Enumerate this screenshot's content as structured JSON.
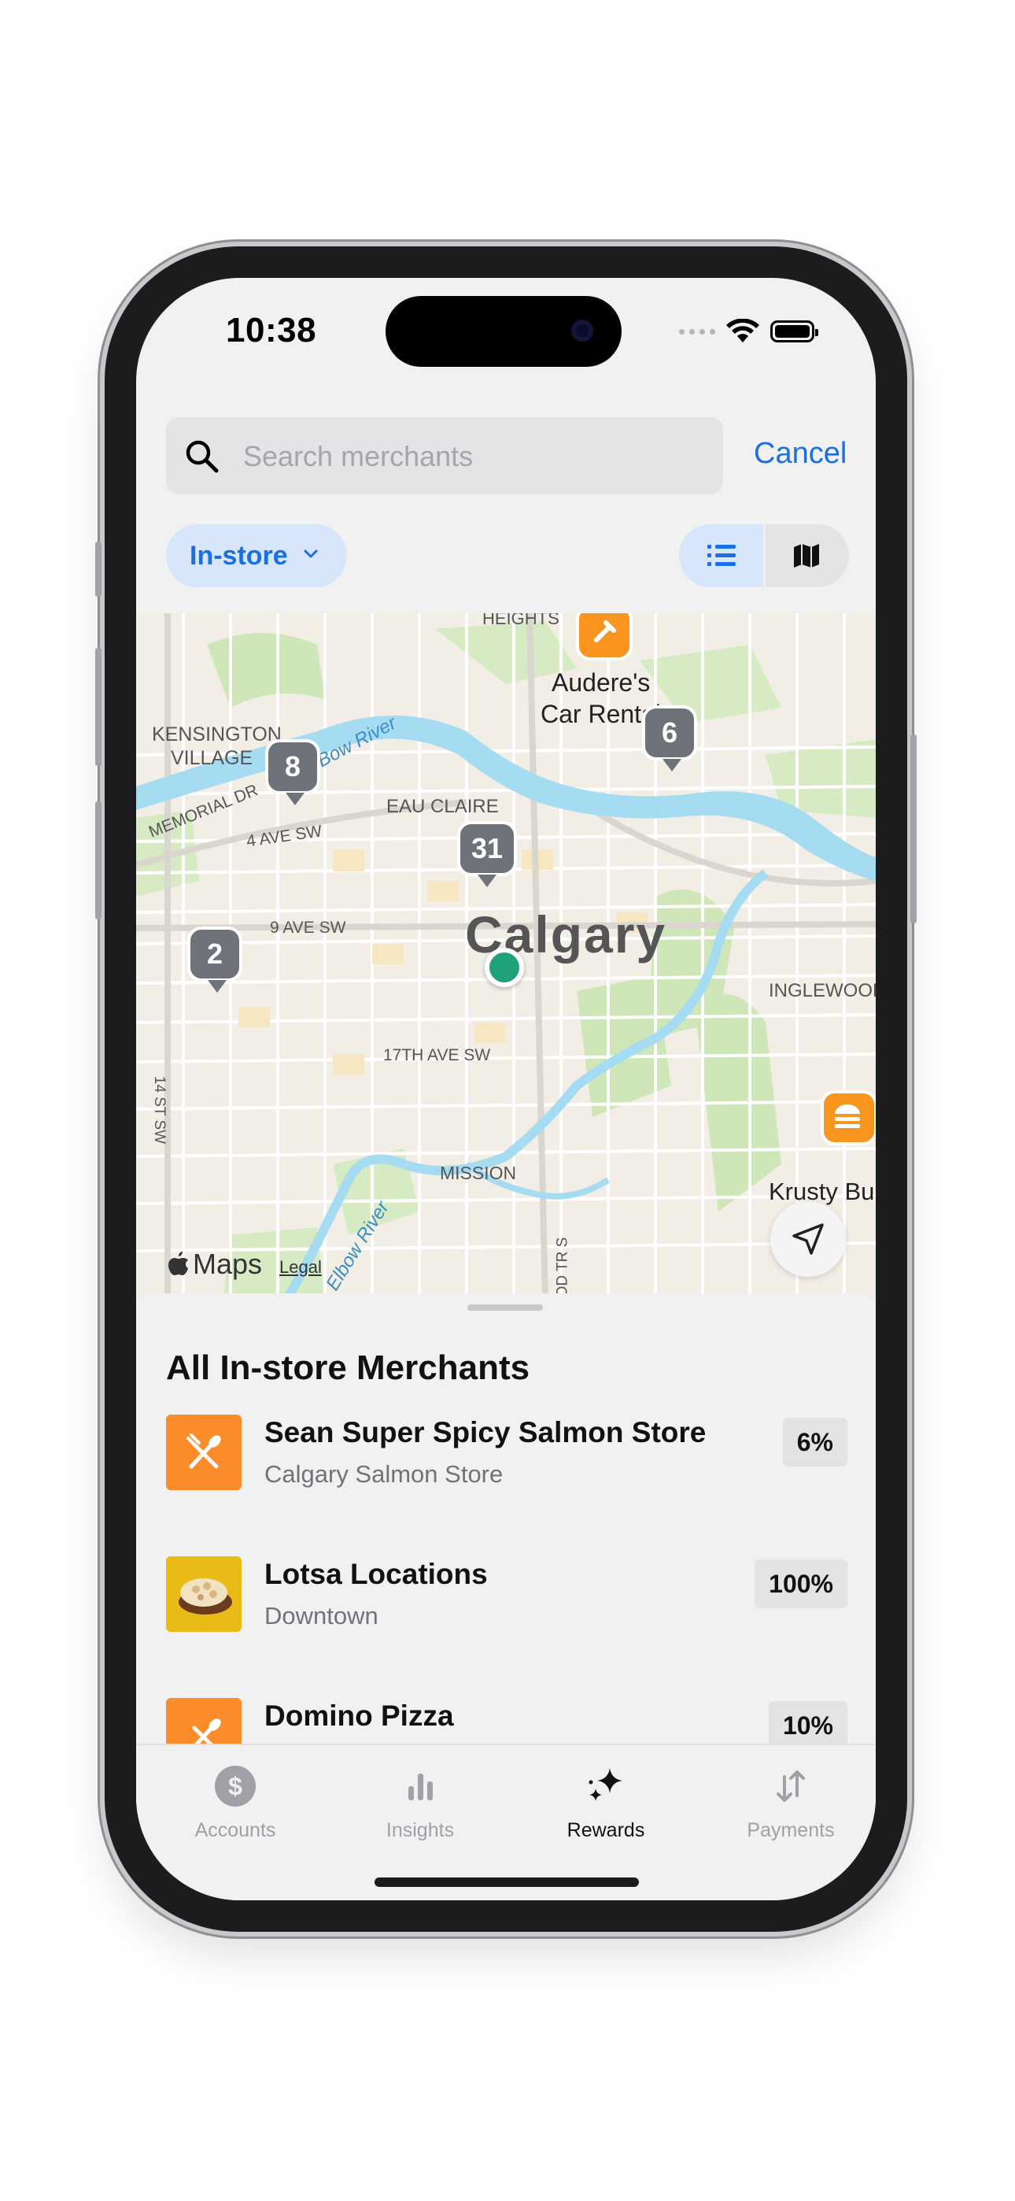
{
  "status_bar": {
    "time": "10:38"
  },
  "search": {
    "placeholder": "Search merchants",
    "cancel_label": "Cancel"
  },
  "filter": {
    "selected": "In-store",
    "view_options": [
      "list-icon",
      "map-icon"
    ],
    "active_view": "list"
  },
  "map": {
    "labels": {
      "heights": "HEIGHTS",
      "audere": "Audere's",
      "car_rental": "Car Rental",
      "kensington": "KENSINGTON",
      "village": "VILLAGE",
      "bow_river": "Bow River",
      "memorial_dr": "MEMORIAL DR",
      "ave4": "4 AVE SW",
      "eau_claire": "EAU CLAIRE",
      "calgary": "Calgary",
      "ave9": "9 AVE SW",
      "inglewood": "INGLEWOOD",
      "ave17": "17TH AVE SW",
      "st14": "14 ST SW",
      "mission": "MISSION",
      "elbow_river": "Elbow River",
      "krusty": "Krusty Bu",
      "od_tr": "OD TR S"
    },
    "clusters": [
      "8",
      "6",
      "31",
      "2"
    ],
    "attribution": "Maps",
    "legal": "Legal"
  },
  "sheet": {
    "title": "All In-store Merchants",
    "merchants": [
      {
        "name": "Sean Super Spicy Salmon Store",
        "subtitle": "Calgary Salmon Store",
        "reward": "6%",
        "icon": "fork-knife-icon"
      },
      {
        "name": "Lotsa Locations",
        "subtitle": "Downtown",
        "reward": "100%",
        "icon": "food-photo"
      },
      {
        "name": "Domino Pizza",
        "subtitle": "",
        "reward": "10%",
        "icon": "fork-knife-icon"
      }
    ]
  },
  "tabs": [
    {
      "label": "Accounts",
      "icon": "dollar-icon"
    },
    {
      "label": "Insights",
      "icon": "bar-chart-icon"
    },
    {
      "label": "Rewards",
      "icon": "sparkle-icon",
      "active": true
    },
    {
      "label": "Payments",
      "icon": "arrows-icon"
    }
  ],
  "colors": {
    "accent": "#1b6fe0",
    "pin_gray": "#6f7278",
    "pin_orange": "#f7951f",
    "user_dot": "#1fa179"
  }
}
